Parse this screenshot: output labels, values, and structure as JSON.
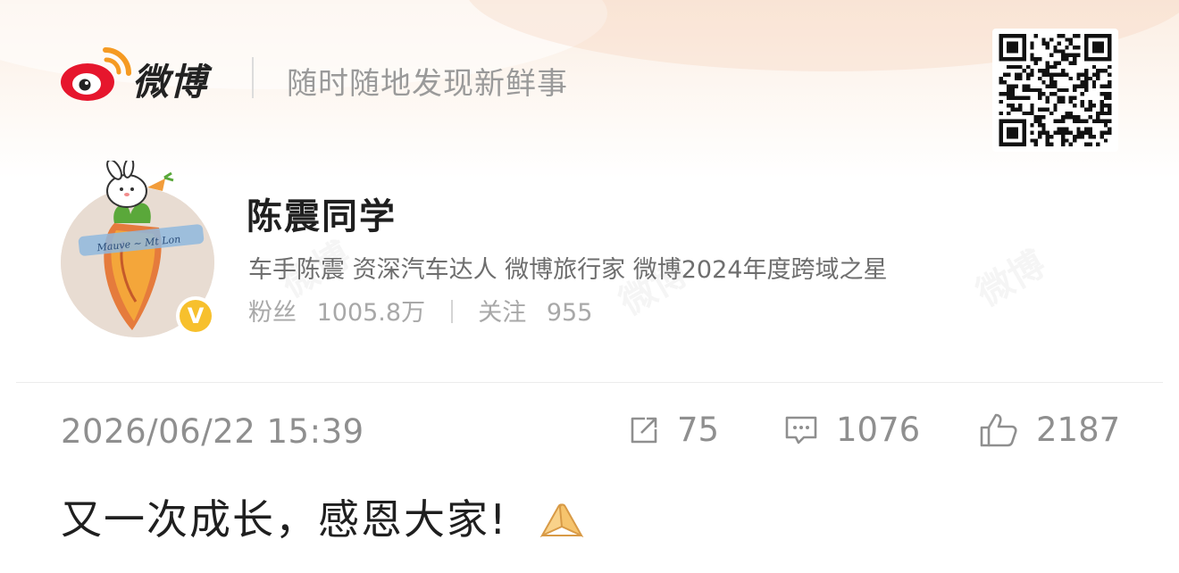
{
  "header": {
    "brand": "微博",
    "slogan": "随时随地发现新鲜事",
    "logo_icon": "weibo-logo-icon",
    "qr_icon": "qr-code-icon"
  },
  "user": {
    "name": "陈震同学",
    "tags": "车手陈震 资深汽车达人  微博旅行家 微博2024年度跨域之星",
    "followers_label": "粉丝",
    "followers_value": "1005.8万",
    "following_label": "关注",
    "following_value": "955",
    "verified_badge": "V",
    "watermark": "微博"
  },
  "post": {
    "time": "2026/06/22 15:39",
    "shares": "75",
    "comments": "1076",
    "likes": "2187",
    "text": "又一次成长，感恩大家!",
    "emoji_icon": "praying-hands-icon"
  },
  "colors": {
    "weibo_red": "#e6162d",
    "weibo_orange": "#ff9933",
    "badge_yellow": "#f7c02d",
    "text_dark": "#1f1f1f",
    "text_gray": "#8f8f8f"
  }
}
